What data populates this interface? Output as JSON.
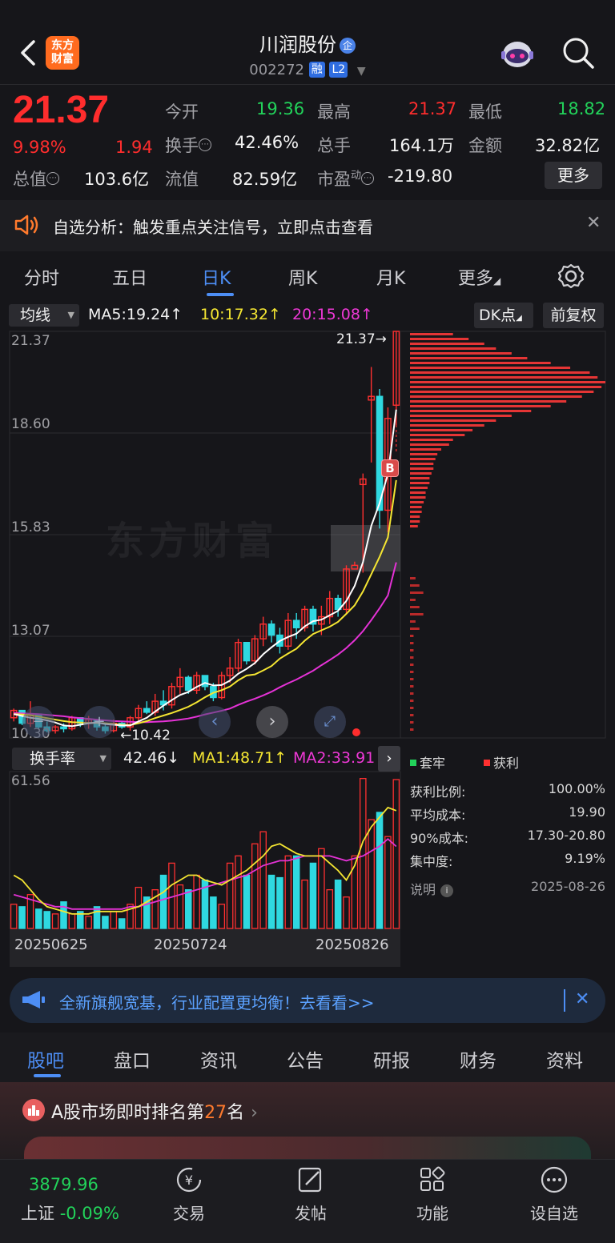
{
  "header": {
    "title": "川润股份",
    "title_badge": "企",
    "code": "002272",
    "tag_margin": "融",
    "tag_l2": "L2",
    "logo_text": "东方\n财富"
  },
  "quote": {
    "price": "21.37",
    "change_pct": "9.98%",
    "change_amt": "1.94",
    "open_label": "今开",
    "open": "19.36",
    "high_label": "最高",
    "high": "21.37",
    "low_label": "最低",
    "low": "18.82",
    "turnover_label": "换手",
    "turnover": "42.46%",
    "volume_label": "总手",
    "volume": "164.1万",
    "amount_label": "金额",
    "amount": "32.82亿",
    "mktcap_label": "总值",
    "mktcap": "103.6亿",
    "float_label": "流值",
    "float": "82.59亿",
    "pe_label": "市盈",
    "pe_sup": "动",
    "pe": "-219.80",
    "more": "更多"
  },
  "notice": {
    "text": "自选分析：触发重点关注信号，立即点击查看"
  },
  "ktabs": [
    "分时",
    "五日",
    "日K",
    "周K",
    "月K",
    "更多"
  ],
  "chart": {
    "ma_selector": "均线",
    "ma5": "MA5:19.24↑",
    "ma10": "10:17.32↑",
    "ma20": "20:15.08↑",
    "dk_button": "DK点",
    "adjust_button": "前复权",
    "price_labels": [
      "21.37",
      "18.60",
      "15.83",
      "13.07",
      "10.30"
    ],
    "high_marker": "21.37→",
    "low_marker": "←10.42",
    "buy_marker": "B",
    "watermark": "东方财富",
    "sub_selector": "换手率",
    "sub_value": "42.46↓",
    "sub_ma1": "MA1:48.71↑",
    "sub_ma2": "MA2:33.91↑",
    "sub_max": "61.56",
    "dates": [
      "20250625",
      "20250724",
      "20250826"
    ],
    "colors": {
      "up": "#ff3030",
      "down": "#2fd8e0",
      "ma5": "#ffffff",
      "ma10": "#f5e632",
      "ma20": "#e532d6"
    }
  },
  "chart_data": {
    "type": "candlestick",
    "candles": [
      [
        10.85,
        11.1,
        10.75,
        11.05
      ],
      [
        11.05,
        11.0,
        10.65,
        10.7
      ],
      [
        10.7,
        11.3,
        10.6,
        10.95
      ],
      [
        10.95,
        10.8,
        10.55,
        10.6
      ],
      [
        10.6,
        10.75,
        10.45,
        10.5
      ],
      [
        10.5,
        10.65,
        10.42,
        10.6
      ],
      [
        10.6,
        10.7,
        10.45,
        10.55
      ],
      [
        10.55,
        10.9,
        10.5,
        10.85
      ],
      [
        10.85,
        10.8,
        10.6,
        10.7
      ],
      [
        10.7,
        10.9,
        10.55,
        10.8
      ],
      [
        10.8,
        10.75,
        10.5,
        10.6
      ],
      [
        10.6,
        10.7,
        10.42,
        10.5
      ],
      [
        10.5,
        10.8,
        10.45,
        10.7
      ],
      [
        10.7,
        10.75,
        10.55,
        10.6
      ],
      [
        10.6,
        10.9,
        10.5,
        10.85
      ],
      [
        10.85,
        11.2,
        10.75,
        11.1
      ],
      [
        11.1,
        11.3,
        10.95,
        11.0
      ],
      [
        11.0,
        11.5,
        10.9,
        11.3
      ],
      [
        11.3,
        11.6,
        11.05,
        11.2
      ],
      [
        11.2,
        11.8,
        11.1,
        11.7
      ],
      [
        11.7,
        12.2,
        11.5,
        11.95
      ],
      [
        11.95,
        12.0,
        11.5,
        11.6
      ],
      [
        11.6,
        12.1,
        11.5,
        12.0
      ],
      [
        12.0,
        12.0,
        11.6,
        11.7
      ],
      [
        11.7,
        11.8,
        11.3,
        11.4
      ],
      [
        11.4,
        12.1,
        11.35,
        12.0
      ],
      [
        12.0,
        12.5,
        11.8,
        12.2
      ],
      [
        12.2,
        13.0,
        12.1,
        12.9
      ],
      [
        12.9,
        12.8,
        12.3,
        12.4
      ],
      [
        12.4,
        13.1,
        12.3,
        13.0
      ],
      [
        13.0,
        13.6,
        12.8,
        13.4
      ],
      [
        13.4,
        13.5,
        12.9,
        13.1
      ],
      [
        13.1,
        13.3,
        12.6,
        12.8
      ],
      [
        12.8,
        13.7,
        12.7,
        13.5
      ],
      [
        13.5,
        13.7,
        13.0,
        13.3
      ],
      [
        13.3,
        13.9,
        13.2,
        13.8
      ],
      [
        13.8,
        13.9,
        13.2,
        13.4
      ],
      [
        13.4,
        13.9,
        13.1,
        13.6
      ],
      [
        13.6,
        14.3,
        13.4,
        14.1
      ],
      [
        14.1,
        14.2,
        13.6,
        13.8
      ],
      [
        13.8,
        15.0,
        13.7,
        14.9
      ],
      [
        14.9,
        15.1,
        15.0,
        15.0
      ],
      [
        17.2,
        17.5,
        14.8,
        17.35
      ],
      [
        19.5,
        20.4,
        17.8,
        19.6
      ],
      [
        19.6,
        19.8,
        16.0,
        16.5
      ],
      [
        16.5,
        19.3,
        15.9,
        19.0
      ],
      [
        19.36,
        21.37,
        18.82,
        21.37
      ]
    ],
    "ma5": [
      10.95,
      10.9,
      10.85,
      10.82,
      10.78,
      10.72,
      10.64,
      10.62,
      10.66,
      10.7,
      10.72,
      10.68,
      10.66,
      10.64,
      10.64,
      10.75,
      10.85,
      11.02,
      11.18,
      11.33,
      11.47,
      11.55,
      11.69,
      11.8,
      11.73,
      11.74,
      11.86,
      12.05,
      12.18,
      12.34,
      12.58,
      12.77,
      12.94,
      13.05,
      13.14,
      13.34,
      13.48,
      13.52,
      13.64,
      13.76,
      14.03,
      14.44,
      15.09,
      16.08,
      16.69,
      17.49,
      19.24
    ],
    "ma10": [
      10.95,
      10.94,
      10.92,
      10.88,
      10.84,
      10.8,
      10.76,
      10.73,
      10.72,
      10.71,
      10.71,
      10.7,
      10.68,
      10.66,
      10.65,
      10.7,
      10.76,
      10.84,
      10.91,
      10.98,
      11.06,
      11.15,
      11.27,
      11.41,
      11.53,
      11.6,
      11.7,
      11.87,
      12.0,
      12.03,
      12.14,
      12.26,
      12.46,
      12.6,
      12.73,
      12.95,
      13.13,
      13.23,
      13.33,
      13.46,
      13.68,
      13.91,
      14.29,
      14.76,
      15.23,
      15.76,
      17.32
    ],
    "ma20": [
      10.98,
      10.97,
      10.96,
      10.95,
      10.93,
      10.91,
      10.89,
      10.86,
      10.84,
      10.82,
      10.8,
      10.78,
      10.76,
      10.75,
      10.74,
      10.73,
      10.73,
      10.74,
      10.75,
      10.77,
      10.8,
      10.83,
      10.88,
      10.94,
      10.99,
      11.04,
      11.1,
      11.2,
      11.29,
      11.37,
      11.46,
      11.56,
      11.68,
      11.79,
      11.89,
      12.01,
      12.13,
      12.28,
      12.42,
      12.57,
      12.75,
      12.96,
      13.21,
      13.51,
      13.83,
      14.18,
      15.08
    ],
    "turnover": [
      10,
      9,
      14,
      8,
      7,
      6,
      11,
      6,
      7,
      5,
      9,
      5,
      7,
      4,
      10,
      17,
      13,
      16,
      22,
      27,
      18,
      16,
      22,
      20,
      13,
      10,
      27,
      30,
      22,
      35,
      40,
      22,
      21,
      30,
      30,
      20,
      27,
      33,
      16,
      20,
      13,
      30,
      62,
      45,
      48,
      38,
      61.56
    ],
    "turnover_ma1": [
      22,
      20,
      16,
      12,
      9,
      8,
      7,
      6,
      6,
      6,
      7,
      7,
      7,
      7,
      8,
      9,
      11,
      13,
      15,
      18,
      20,
      22,
      22,
      20,
      19,
      18,
      20,
      22,
      24,
      27,
      30,
      34,
      35,
      33,
      31,
      30,
      30,
      30,
      27,
      24,
      20,
      26,
      36,
      42,
      46,
      50,
      48.71
    ],
    "turnover_ma2": [
      14,
      13,
      12,
      11,
      10,
      9,
      9,
      8,
      8,
      8,
      8,
      8,
      8,
      8,
      9,
      9,
      10,
      11,
      12,
      13,
      14,
      15,
      16,
      17,
      18,
      19,
      20,
      21,
      22,
      24,
      26,
      27,
      28,
      28,
      29,
      30,
      30,
      30,
      30,
      29,
      28,
      29,
      30,
      32,
      34,
      37,
      33.91
    ],
    "ylim": [
      10.3,
      21.37
    ],
    "turnover_ylim": [
      0,
      61.56
    ],
    "chip_distribution": {
      "legend": [
        "套牢",
        "获利"
      ],
      "rows": [
        {
          "label": "获利比例:",
          "value": "100.00%"
        },
        {
          "label": "平均成本:",
          "value": "19.90"
        },
        {
          "label": "90%成本:",
          "value": "17.30-20.80"
        },
        {
          "label": "集中度:",
          "value": "9.19%"
        }
      ],
      "note_label": "说明",
      "date": "2025-08-26"
    }
  },
  "banner": {
    "text": "全新旗舰宽基，行业配置更均衡！去看看>>"
  },
  "bottom_tabs": [
    "股吧",
    "盘口",
    "资讯",
    "公告",
    "研报",
    "财务",
    "资料"
  ],
  "rank": {
    "prefix": "A股市场即时排名第",
    "rank": "27",
    "suffix": "名"
  },
  "nav": {
    "index_value": "3879.96",
    "index_name": "上证",
    "index_change": "-0.09%",
    "items": [
      "交易",
      "发帖",
      "功能",
      "设自选"
    ]
  }
}
